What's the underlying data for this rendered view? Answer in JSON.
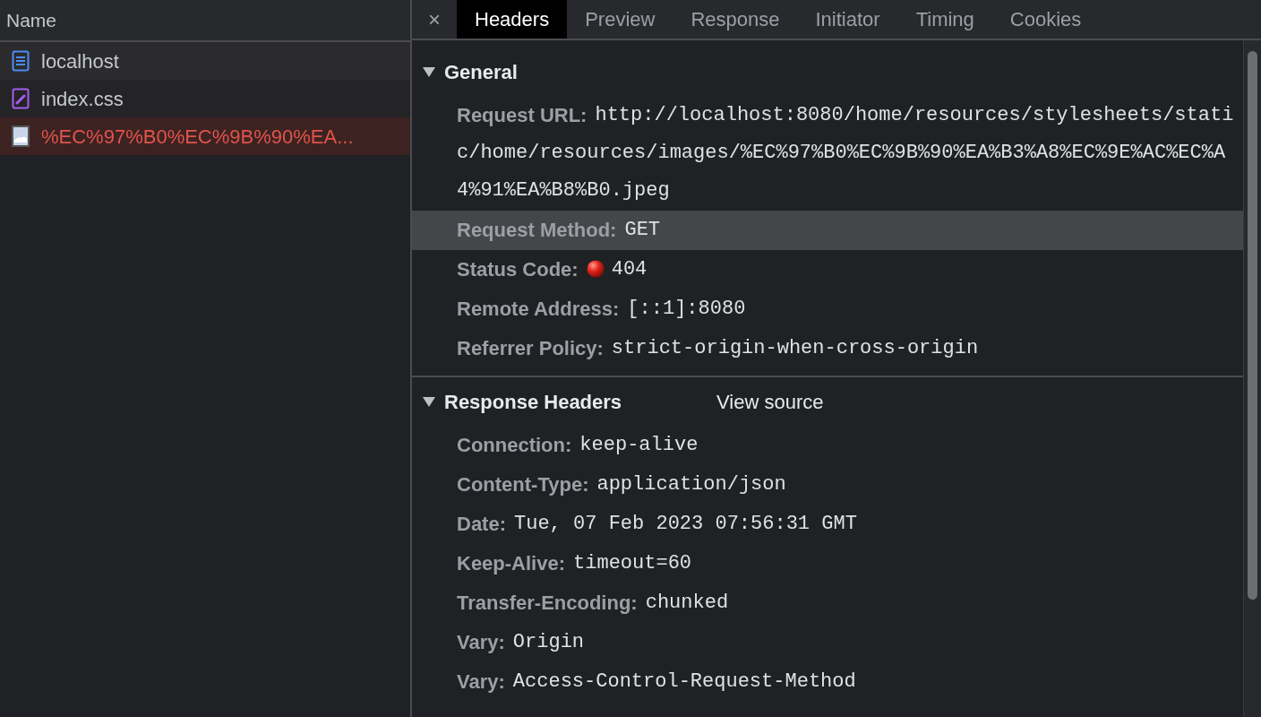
{
  "requests_panel": {
    "column_header": "Name",
    "requests": [
      {
        "kind": "document",
        "name": "localhost",
        "selected": false,
        "error": false
      },
      {
        "kind": "stylesheet",
        "name": "index.css",
        "selected": false,
        "error": false
      },
      {
        "kind": "image",
        "name": "%EC%97%B0%EC%9B%90%EA...",
        "selected": true,
        "error": true
      }
    ]
  },
  "details": {
    "close_label": "×",
    "tabs": [
      {
        "label": "Headers",
        "selected": true
      },
      {
        "label": "Preview",
        "selected": false
      },
      {
        "label": "Response",
        "selected": false
      },
      {
        "label": "Initiator",
        "selected": false
      },
      {
        "label": "Timing",
        "selected": false
      },
      {
        "label": "Cookies",
        "selected": false
      }
    ],
    "sections": [
      {
        "title": "General",
        "expanded": true,
        "rows": [
          {
            "name": "Request URL:",
            "value": "http://localhost:8080/home/resources/stylesheets/static/home/resources/images/%EC%97%B0%EC%9B%90%EA%B3%A8%EC%9E%AC%EC%A4%91%EA%B8%B0.jpeg",
            "highlighted": false
          },
          {
            "name": "Request Method:",
            "value": "GET",
            "highlighted": true
          },
          {
            "name": "Status Code:",
            "value": "404",
            "highlighted": false,
            "status_dot": true
          },
          {
            "name": "Remote Address:",
            "value": "[::1]:8080",
            "highlighted": false
          },
          {
            "name": "Referrer Policy:",
            "value": "strict-origin-when-cross-origin",
            "highlighted": false
          }
        ]
      },
      {
        "title": "Response Headers",
        "expanded": true,
        "link": "View source",
        "rows": [
          {
            "name": "Connection:",
            "value": "keep-alive",
            "highlighted": false
          },
          {
            "name": "Content-Type:",
            "value": "application/json",
            "highlighted": false
          },
          {
            "name": "Date:",
            "value": "Tue, 07 Feb 2023 07:56:31 GMT",
            "highlighted": false
          },
          {
            "name": "Keep-Alive:",
            "value": "timeout=60",
            "highlighted": false
          },
          {
            "name": "Transfer-Encoding:",
            "value": "chunked",
            "highlighted": false
          },
          {
            "name": "Vary:",
            "value": "Origin",
            "highlighted": false
          },
          {
            "name": "Vary:",
            "value": "Access-Control-Request-Method",
            "highlighted": false
          }
        ]
      }
    ]
  }
}
